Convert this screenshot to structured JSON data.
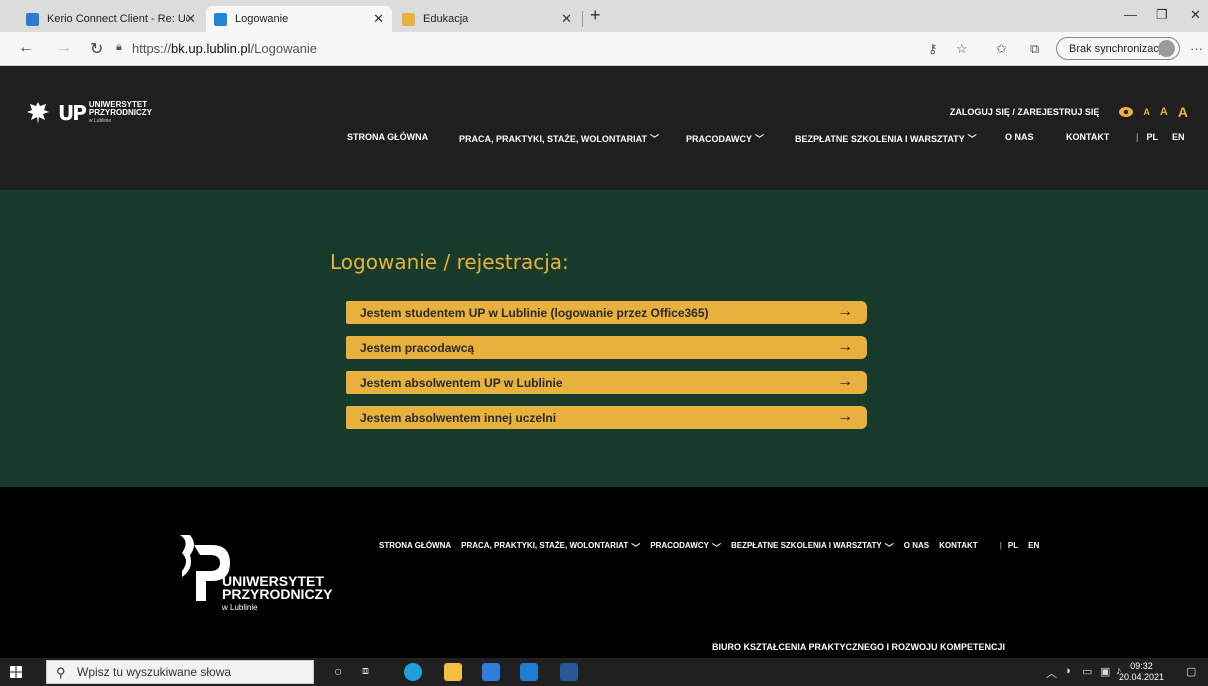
{
  "browser": {
    "tabs": [
      {
        "title": "Kerio Connect Client - Re: Udział",
        "icon": "kerio-icon"
      },
      {
        "title": "Logowanie",
        "icon": "page-icon"
      },
      {
        "title": "Edukacja",
        "icon": "edu-icon"
      }
    ],
    "url_prefix": "https://",
    "url_domain": "bk.up.lublin.pl",
    "url_path": "/Logowanie",
    "sync_label": "Brak synchronizacji"
  },
  "header": {
    "logo_line1": "UNIWERSYTET",
    "logo_line2": "PRZYRODNICZY",
    "logo_line3": "w Lublinie",
    "login_link": "ZALOGUJ SIĘ / ZAREJESTRUJ SIĘ",
    "font_sizes": [
      "A",
      "A",
      "A"
    ],
    "nav": [
      {
        "label": "STRONA GŁÓWNA"
      },
      {
        "label": "PRACA, PRAKTYKI, STAŻE, WOLONTARIAT"
      },
      {
        "label": "PRACODAWCY"
      },
      {
        "label": "BEZPŁATNE SZKOLENIA I WARSZTATY"
      },
      {
        "label": "O NAS"
      },
      {
        "label": "KONTAKT"
      }
    ],
    "lang": [
      "PL",
      "EN"
    ]
  },
  "content": {
    "title": "Logowanie / rejestracja:",
    "options": [
      "Jestem studentem UP w Lublinie (logowanie przez Office365)",
      "Jestem pracodawcą",
      "Jestem absolwentem UP w Lublinie",
      "Jestem absolwentem innej uczelni"
    ],
    "arrow": "→"
  },
  "footer": {
    "logo_line1": "UNIWERSYTET",
    "logo_line2": "PRZYRODNICZY",
    "logo_line3": "w Lublinie",
    "nav": [
      "STRONA GŁÓWNA",
      "PRACA, PRAKTYKI, STAŻE, WOLONTARIAT",
      "PRACODAWCY",
      "BEZPŁATNE SZKOLENIA I WARSZTATY",
      "O NAS",
      "KONTAKT"
    ],
    "lang": [
      "PL",
      "EN"
    ],
    "office": "BIURO KSZTAŁCENIA PRAKTYCZNEGO I ROZWOJU KOMPETENCJI"
  },
  "taskbar": {
    "search_placeholder": "Wpisz tu wyszukiwane słowa",
    "time": "09:32",
    "date": "20.04.2021"
  },
  "colors": {
    "accent": "#e8b13d",
    "header_bg": "#1f1f1f",
    "content_bg": "#173a2a",
    "footer_bg": "#000000"
  }
}
